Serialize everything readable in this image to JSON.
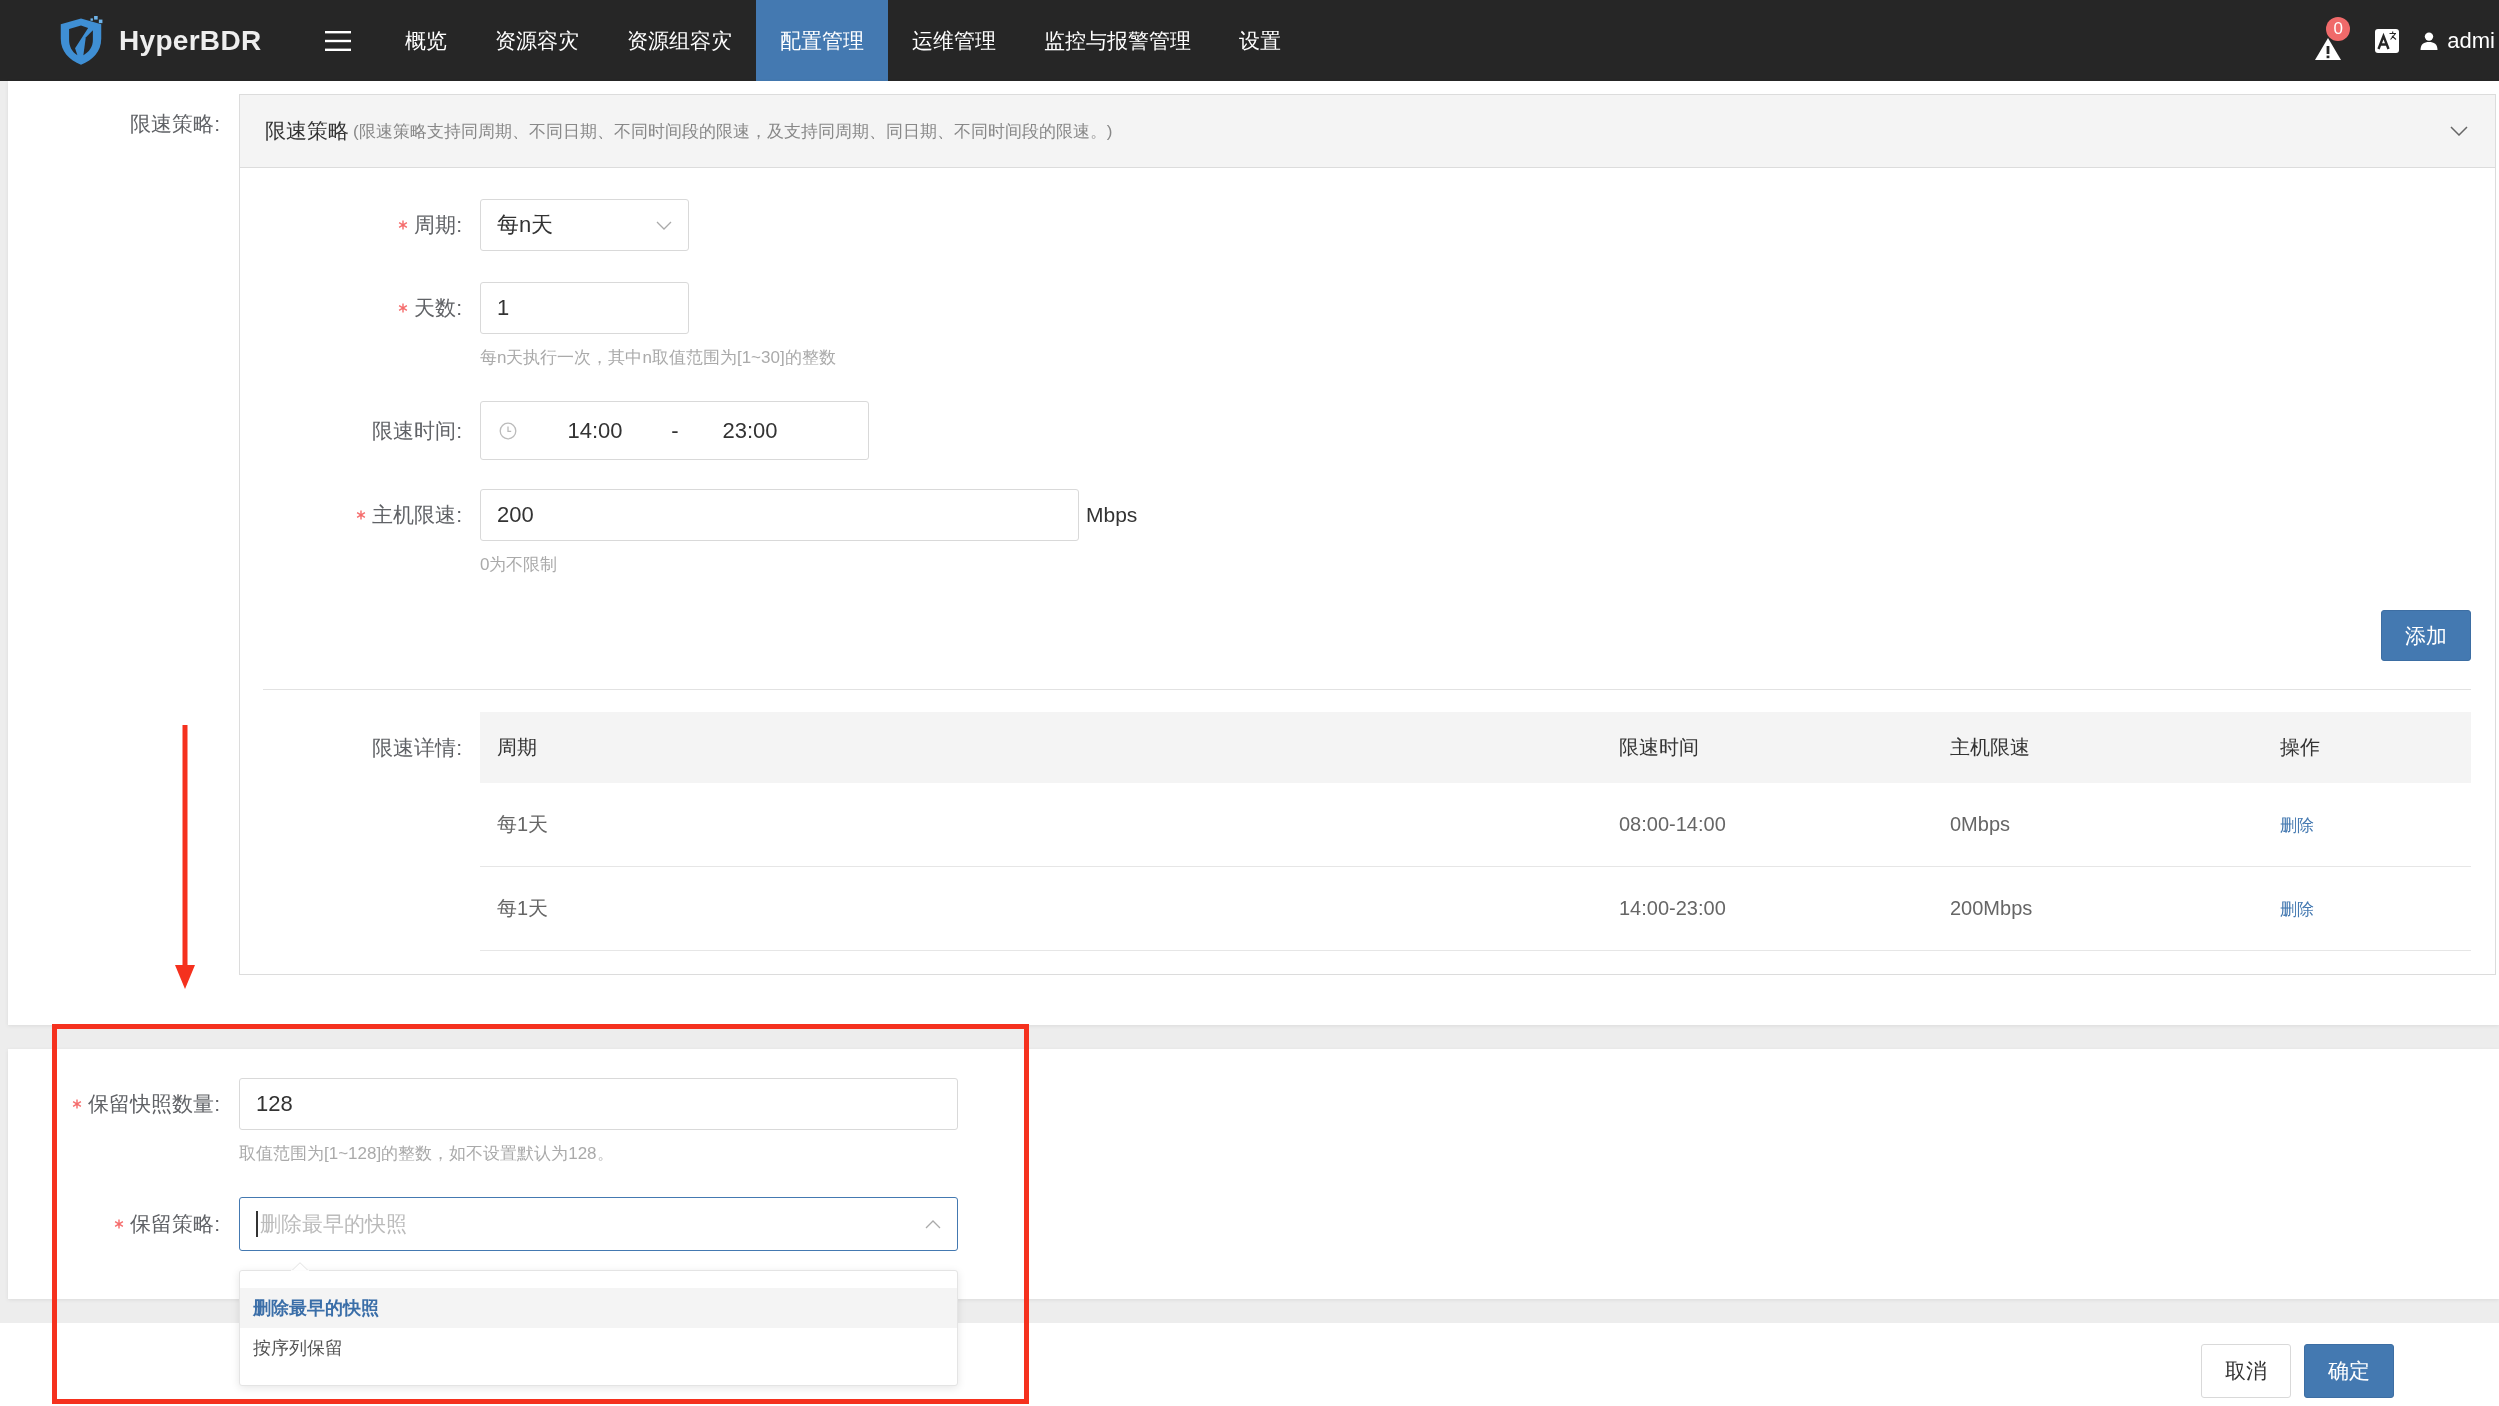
{
  "header": {
    "brand": "HyperBDR",
    "nav": [
      {
        "label": "概览",
        "selected": false
      },
      {
        "label": "资源容灾",
        "selected": false
      },
      {
        "label": "资源组容灾",
        "selected": false
      },
      {
        "label": "配置管理",
        "selected": true
      },
      {
        "label": "运维管理",
        "selected": false
      },
      {
        "label": "监控与报警管理",
        "selected": false
      },
      {
        "label": "设置",
        "selected": false
      }
    ],
    "alert_count": "0",
    "user": "admi"
  },
  "rate_limit": {
    "label": "限速策略:",
    "panel": {
      "title": "限速策略",
      "note": "(限速策略支持同周期、不同日期、不同时间段的限速，及支持同周期、同日期、不同时间段的限速。)",
      "expanded": true
    },
    "period": {
      "label": "周期:",
      "required": true,
      "value": "每n天"
    },
    "days": {
      "label": "天数:",
      "required": true,
      "value": "1",
      "help": "每n天执行一次，其中n取值范围为[1~30]的整数"
    },
    "limit_time": {
      "label": "限速时间:",
      "required": false,
      "start": "14:00",
      "separator": "-",
      "end": "23:00"
    },
    "host_limit": {
      "label": "主机限速:",
      "required": true,
      "value": "200",
      "unit": "Mbps",
      "help": "0为不限制"
    },
    "add_button": "添加",
    "details": {
      "label": "限速详情:",
      "columns": [
        "周期",
        "限速时间",
        "主机限速",
        "操作"
      ],
      "rows": [
        {
          "period": "每1天",
          "time": "08:00-14:00",
          "limit": "0Mbps",
          "action": "删除"
        },
        {
          "period": "每1天",
          "time": "14:00-23:00",
          "limit": "200Mbps",
          "action": "删除"
        }
      ]
    }
  },
  "retention": {
    "snapshot_count": {
      "label": "保留快照数量:",
      "required": true,
      "value": "128",
      "help": "取值范围为[1~128]的整数，如不设置默认为128。"
    },
    "policy": {
      "label": "保留策略:",
      "required": true,
      "placeholder": "删除最早的快照",
      "focused": true,
      "expanded": true,
      "options": [
        {
          "label": "删除最早的快照",
          "selected": true
        },
        {
          "label": "按序列保留",
          "selected": false
        }
      ]
    }
  },
  "footer": {
    "buttons": [
      {
        "label": "取消",
        "kind": "default"
      },
      {
        "label": "确定",
        "kind": "primary"
      }
    ]
  },
  "annotation": {
    "arrow": true,
    "frame": true
  }
}
